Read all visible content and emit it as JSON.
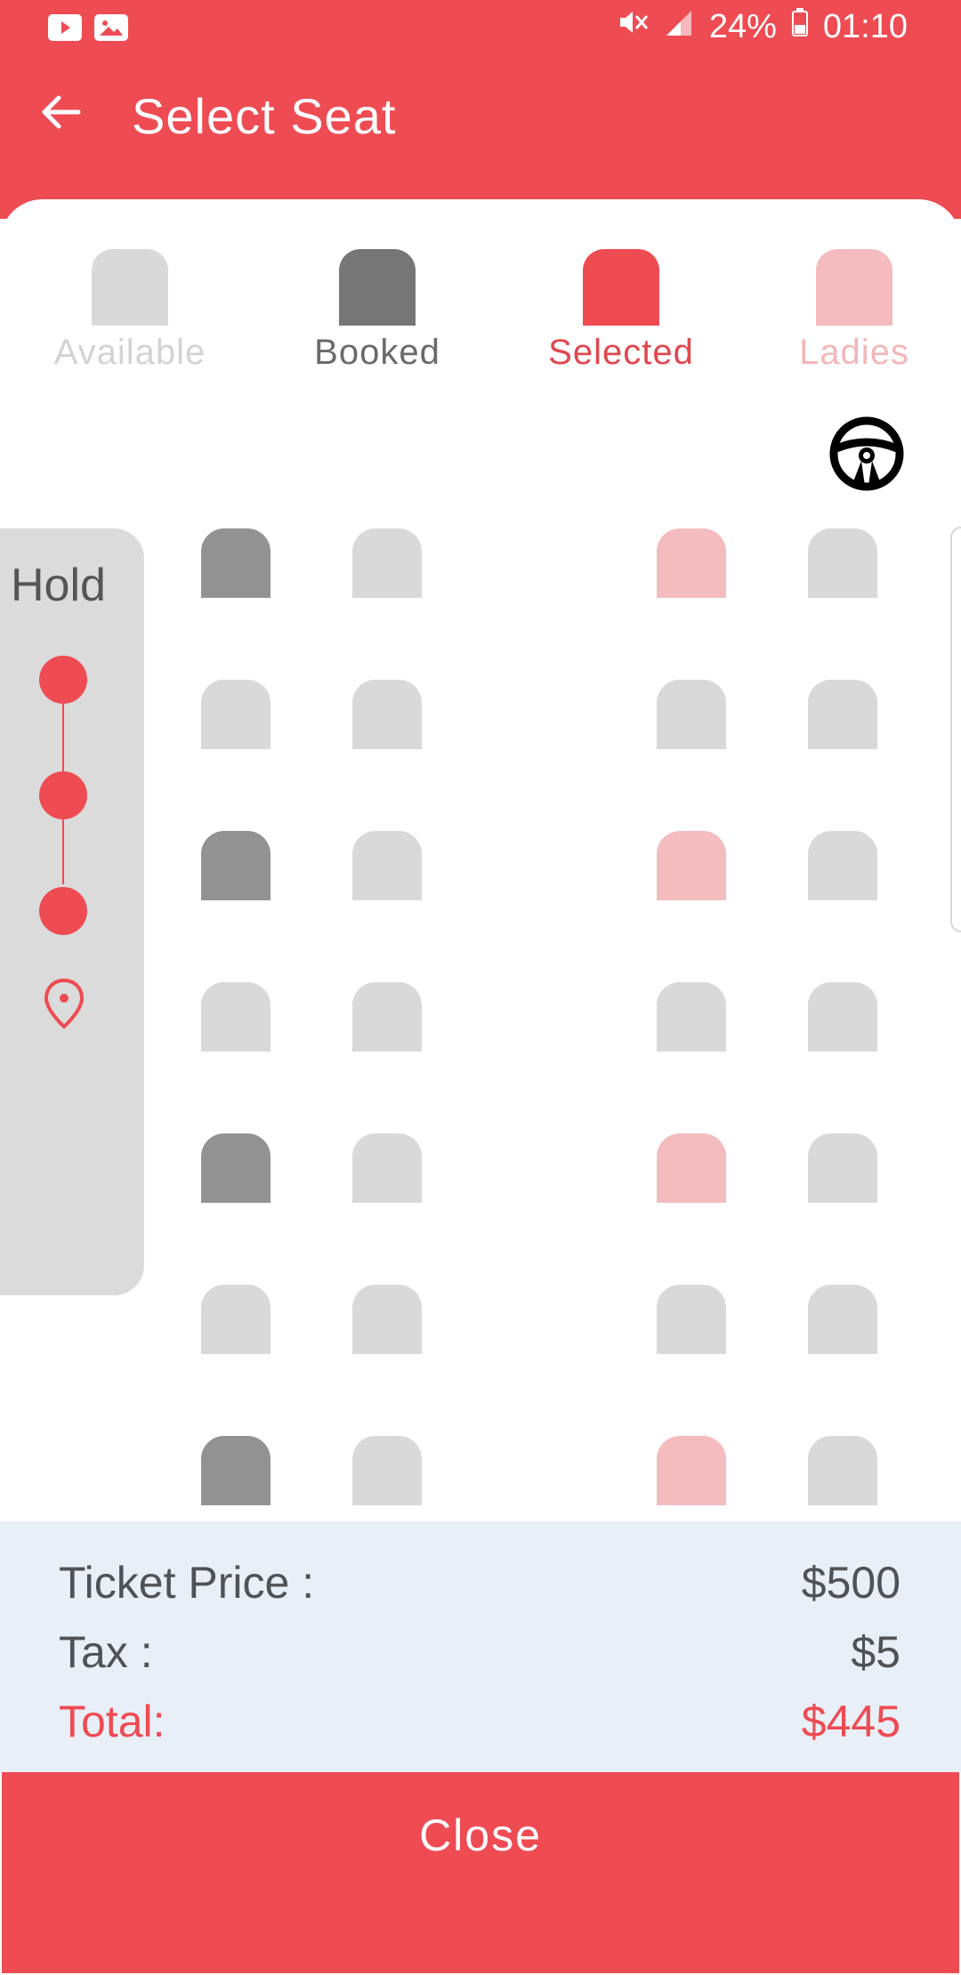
{
  "status_bar": {
    "battery": "24%",
    "time": "01:10",
    "icons": [
      "youtube-icon",
      "gallery-icon",
      "mute-icon",
      "signal-icon",
      "battery-icon"
    ]
  },
  "header": {
    "title": "Select Seat",
    "back_icon": "arrow-back-icon"
  },
  "legend": [
    {
      "label": "Available",
      "color": "#d9d9d9",
      "text_color": "#d3d3d3"
    },
    {
      "label": "Booked",
      "color": "#767676",
      "text_color": "#6a6a6a"
    },
    {
      "label": "Selected",
      "color": "#ee4b53",
      "text_color": "#e0474f"
    },
    {
      "label": "Ladies",
      "color": "#f4bcbe",
      "text_color": "#f2b7b9"
    }
  ],
  "hold": {
    "label": "Hold",
    "stops": 3,
    "destination_icon": "location-pin-icon"
  },
  "seat_map": {
    "rows": [
      [
        "booked",
        "available",
        "ladies",
        "available"
      ],
      [
        "available",
        "available",
        "available",
        "available"
      ],
      [
        "booked",
        "available",
        "ladies",
        "available"
      ],
      [
        "available",
        "available",
        "available",
        "available"
      ],
      [
        "booked",
        "available",
        "ladies",
        "available"
      ],
      [
        "available",
        "available",
        "available",
        "available"
      ],
      [
        "booked",
        "available",
        "ladies",
        "available"
      ]
    ],
    "colors": {
      "available": "#d9d9d9",
      "booked": "#929292",
      "ladies": "#f4bcbe",
      "selected": "#ee4b53"
    }
  },
  "summary": {
    "ticket_price_label": "Ticket Price :",
    "ticket_price_value": "$500",
    "tax_label": "Tax :",
    "tax_value": "$5",
    "total_label": "Total:",
    "total_value": "$445"
  },
  "close_button": "Close",
  "colors": {
    "brand": "#ee4b53",
    "summary_bg": "#e9eff6"
  }
}
